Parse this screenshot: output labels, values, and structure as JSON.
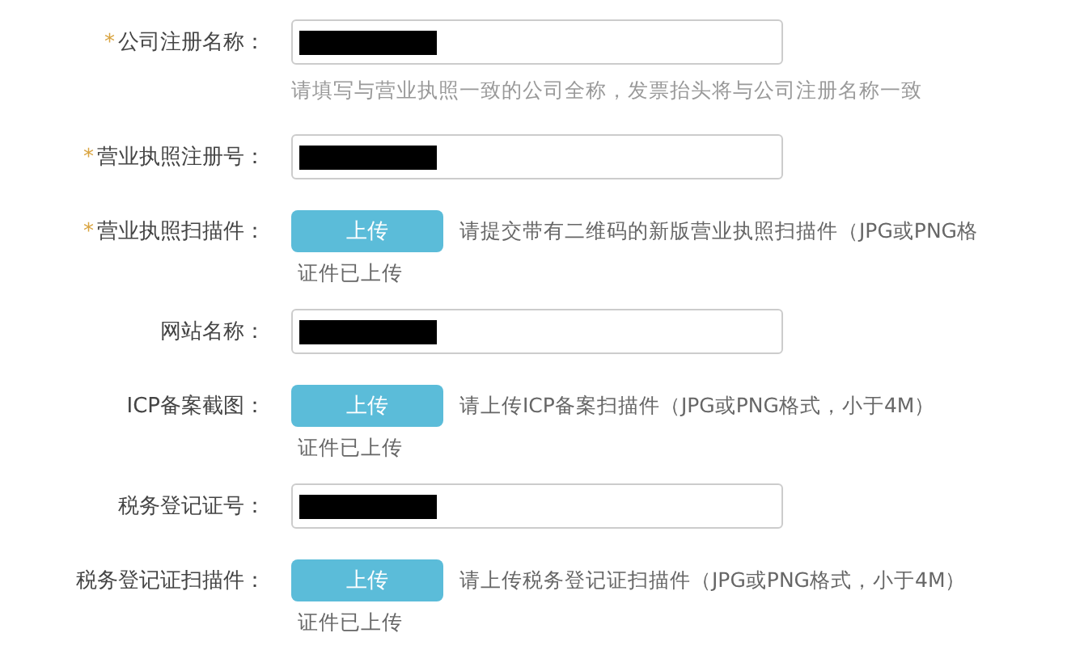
{
  "rows": [
    {
      "kind": "text",
      "required_mark": "*",
      "label": "公司注册名称：",
      "hint": "请填写与营业执照一致的公司全称，发票抬头将与公司注册名称一致"
    },
    {
      "kind": "text",
      "required_mark": "*",
      "label": "营业执照注册号："
    },
    {
      "kind": "upload",
      "required_mark": "*",
      "label": "营业执照扫描件：",
      "button": "上传",
      "hint": "请提交带有二维码的新版营业执照扫描件（JPG或PNG格",
      "status": "证件已上传"
    },
    {
      "kind": "text",
      "label": "网站名称："
    },
    {
      "kind": "upload",
      "label": "ICP备案截图：",
      "button": "上传",
      "hint": "请上传ICP备案扫描件（JPG或PNG格式，小于4M）",
      "status": "证件已上传"
    },
    {
      "kind": "text",
      "label": "税务登记证号："
    },
    {
      "kind": "upload",
      "label": "税务登记证扫描件：",
      "button": "上传",
      "hint": "请上传税务登记证扫描件（JPG或PNG格式，小于4M）",
      "status": "证件已上传"
    }
  ]
}
